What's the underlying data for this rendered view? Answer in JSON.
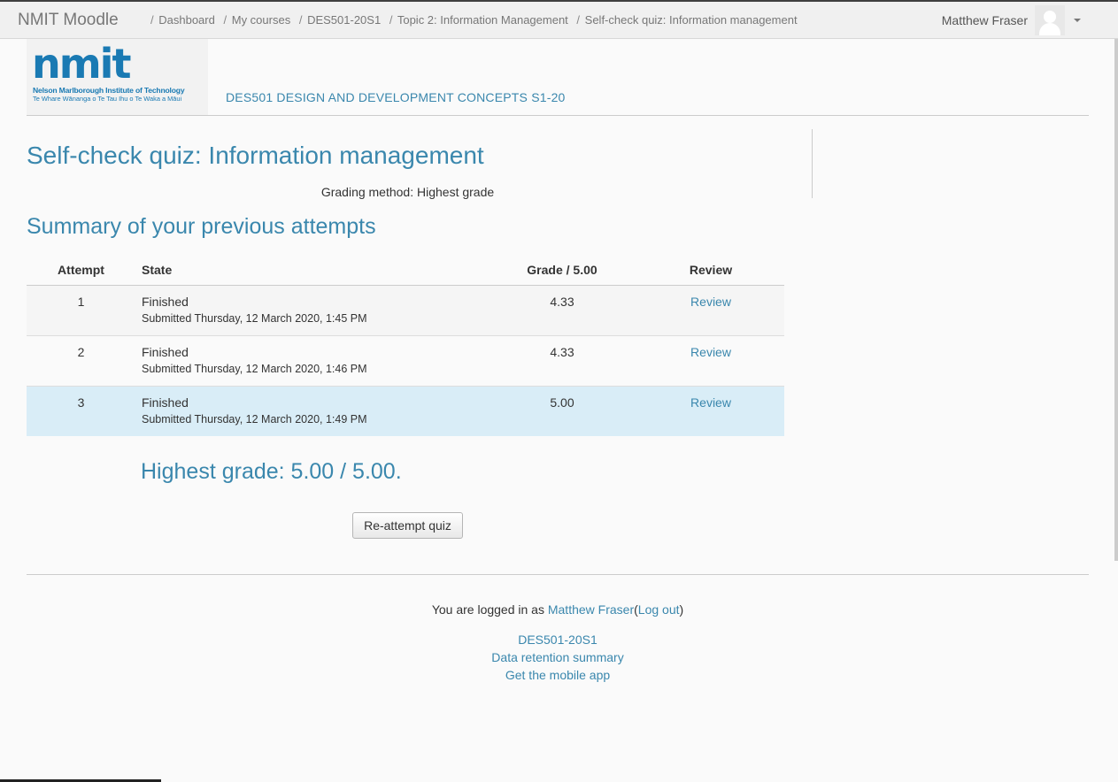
{
  "navbar": {
    "brand": "NMIT Moodle",
    "breadcrumbs": [
      "Dashboard",
      "My courses",
      "DES501-20S1",
      "Topic 2: Information Management",
      "Self-check quiz: Information management"
    ],
    "breadcrumb_separator": "/",
    "user_name": "Matthew Fraser",
    "icons": [
      "avatar-icon",
      "chevron-down-icon"
    ]
  },
  "header": {
    "logo_word": "nmit",
    "logo_line1": "Nelson Marlborough Institute of Technology",
    "logo_line2": "Te Whare Wānanga o Te Tau Ihu o Te Waka a Māui",
    "course_title": "DES501 DESIGN AND DEVELOPMENT CONCEPTS S1-20"
  },
  "main": {
    "quiz_title": "Self-check quiz: Information management",
    "grading_method": "Grading method: Highest grade",
    "summary_heading": "Summary of your previous attempts",
    "table": {
      "headers": {
        "attempt": "Attempt",
        "state": "State",
        "grade": "Grade / 5.00",
        "review": "Review"
      },
      "rows": [
        {
          "attempt": "1",
          "state": "Finished",
          "submitted": "Submitted Thursday, 12 March 2020, 1:45 PM",
          "grade": "4.33",
          "review": "Review"
        },
        {
          "attempt": "2",
          "state": "Finished",
          "submitted": "Submitted Thursday, 12 March 2020, 1:46 PM",
          "grade": "4.33",
          "review": "Review"
        },
        {
          "attempt": "3",
          "state": "Finished",
          "submitted": "Submitted Thursday, 12 March 2020, 1:49 PM",
          "grade": "5.00",
          "review": "Review"
        }
      ]
    },
    "highest_grade": "Highest grade: 5.00 / 5.00.",
    "reattempt_button": "Re-attempt quiz"
  },
  "footer": {
    "logged_in_prefix": "You are logged in as",
    "user_name": "Matthew Fraser",
    "logout_label": "Log out",
    "links": [
      "DES501-20S1",
      "Data retention summary",
      "Get the mobile app"
    ]
  },
  "colors": {
    "accent": "#3a87ad",
    "logo_blue": "#1a7ab3",
    "highlight_row": "#d9edf7"
  }
}
